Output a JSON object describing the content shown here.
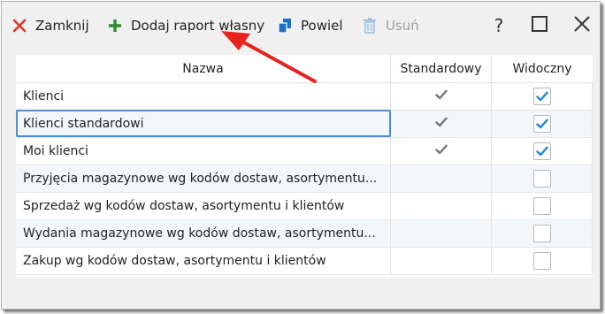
{
  "toolbar": {
    "close_label": "Zamknij",
    "add_report_label": "Dodaj raport własny",
    "duplicate_label": "Powiel",
    "delete_label": "Usuń"
  },
  "window_controls": {
    "help_label": "?"
  },
  "colors": {
    "close_icon": "#e0352b",
    "add_icon": "#2e8b2e",
    "duplicate_icon": "#1e6fc8",
    "delete_icon_disabled": "#9cc3e6",
    "selection_border": "#4a8fd6",
    "checkmark": "#1e88e5",
    "standard_check": "#777777",
    "arrow": "#e8231f"
  },
  "table": {
    "columns": [
      "Nazwa",
      "Standardowy",
      "Widoczny"
    ],
    "rows": [
      {
        "name": "Klienci",
        "standard": true,
        "visible": true
      },
      {
        "name": "Klienci standardowi",
        "standard": true,
        "visible": true
      },
      {
        "name": "Moi klienci",
        "standard": true,
        "visible": true
      },
      {
        "name": "Przyjęcia magazynowe wg kodów dostaw, asortymentu...",
        "standard": false,
        "visible": false
      },
      {
        "name": "Sprzedaż wg kodów dostaw, asortymentu i klientów",
        "standard": false,
        "visible": false
      },
      {
        "name": "Wydania magazynowe wg kodów dostaw, asortymentu...",
        "standard": false,
        "visible": false
      },
      {
        "name": "Zakup wg kodów dostaw, asortymentu i klientów",
        "standard": false,
        "visible": false
      }
    ]
  }
}
